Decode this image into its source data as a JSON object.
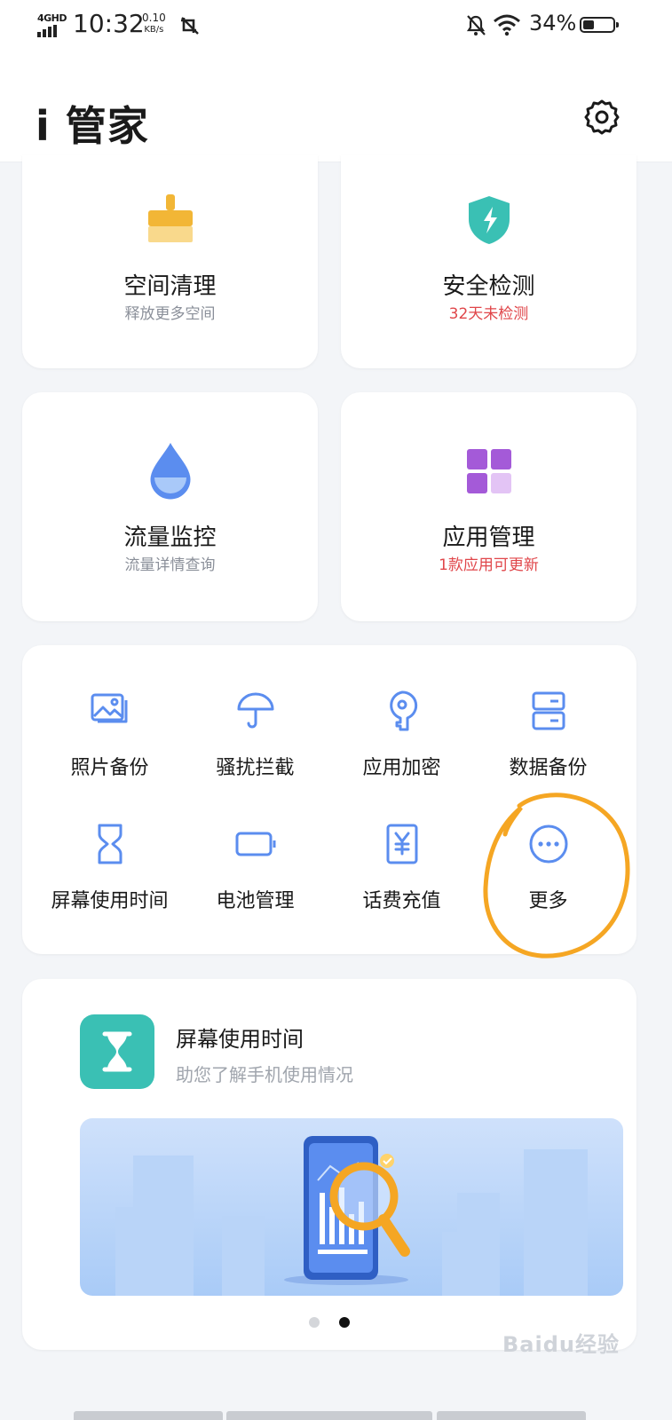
{
  "status_bar": {
    "network": "4GHD",
    "time": "10:32",
    "speed_value": "0.10",
    "speed_unit": "KB/s",
    "battery": "34%"
  },
  "header": {
    "title": "i 管家"
  },
  "feature_cards": [
    {
      "title": "空间清理",
      "subtitle": "释放更多空间",
      "icon": "broom-icon"
    },
    {
      "title": "安全检测",
      "subtitle": "32天未检测",
      "icon": "shield-icon",
      "subtitle_color": "#e0464a"
    },
    {
      "title": "流量监控",
      "subtitle": "流量详情查询",
      "icon": "droplet-icon"
    },
    {
      "title": "应用管理",
      "subtitle": "1款应用可更新",
      "icon": "apps-grid-icon",
      "subtitle_color": "#e0464a"
    }
  ],
  "tools": [
    {
      "label": "照片备份",
      "icon": "photo-icon"
    },
    {
      "label": "骚扰拦截",
      "icon": "umbrella-icon"
    },
    {
      "label": "应用加密",
      "icon": "key-icon"
    },
    {
      "label": "数据备份",
      "icon": "storage-icon"
    },
    {
      "label": "屏幕使用时间",
      "icon": "hourglass-icon"
    },
    {
      "label": "电池管理",
      "icon": "battery-icon"
    },
    {
      "label": "话费充值",
      "icon": "yen-icon"
    },
    {
      "label": "更多",
      "icon": "more-icon"
    }
  ],
  "screen_time_card": {
    "title": "屏幕使用时间",
    "subtitle": "助您了解手机使用情况"
  },
  "watermark": "Baidu经验",
  "colors": {
    "accent_blue": "#5b8def",
    "warning_red": "#e0464a",
    "teal": "#3ac0b4",
    "highlight_orange": "#f5a623"
  }
}
